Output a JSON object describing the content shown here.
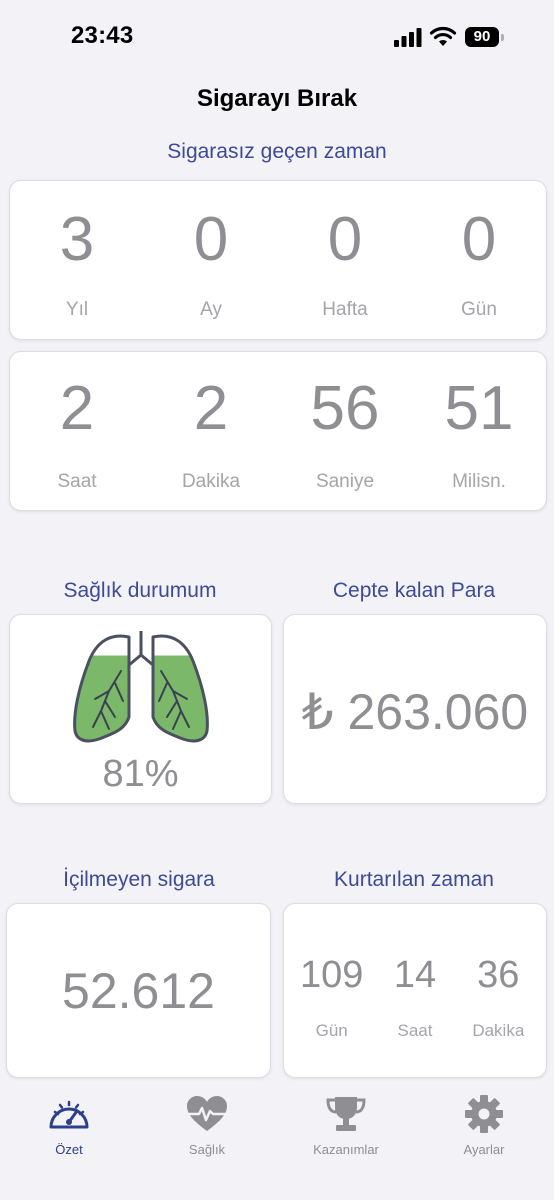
{
  "status_bar": {
    "time": "23:43",
    "battery": "90"
  },
  "header": {
    "title": "Sigarayı Bırak"
  },
  "smoke_free": {
    "section_title": "Sigarasız geçen zaman",
    "row1": [
      {
        "value": "3",
        "label": "Yıl"
      },
      {
        "value": "0",
        "label": "Ay"
      },
      {
        "value": "0",
        "label": "Hafta"
      },
      {
        "value": "0",
        "label": "Gün"
      }
    ],
    "row2": [
      {
        "value": "2",
        "label": "Saat"
      },
      {
        "value": "2",
        "label": "Dakika"
      },
      {
        "value": "56",
        "label": "Saniye"
      },
      {
        "value": "51",
        "label": "Milisn."
      }
    ]
  },
  "health": {
    "section_title": "Sağlık durumum",
    "percent": "81%",
    "icon": "lungs-icon",
    "fill_fraction": 0.81
  },
  "money": {
    "section_title": "Cepte kalan Para",
    "amount": "₺ 263.060"
  },
  "cigarettes": {
    "section_title": "İçilmeyen sigara",
    "count": "52.612"
  },
  "time_saved": {
    "section_title": "Kurtarılan zaman",
    "items": [
      {
        "value": "109",
        "label": "Gün"
      },
      {
        "value": "14",
        "label": "Saat"
      },
      {
        "value": "36",
        "label": "Dakika"
      }
    ]
  },
  "tab_bar": {
    "items": [
      {
        "label": "Özet",
        "icon": "gauge-icon",
        "active": true
      },
      {
        "label": "Sağlık",
        "icon": "heart-pulse-icon",
        "active": false
      },
      {
        "label": "Kazanımlar",
        "icon": "trophy-icon",
        "active": false
      },
      {
        "label": "Ayarlar",
        "icon": "gear-icon",
        "active": false
      }
    ]
  },
  "colors": {
    "accent": "#2b3f8a",
    "section_title": "#3d4a96",
    "lung_fill": "#7cb86a",
    "background": "#f2f2f7"
  }
}
